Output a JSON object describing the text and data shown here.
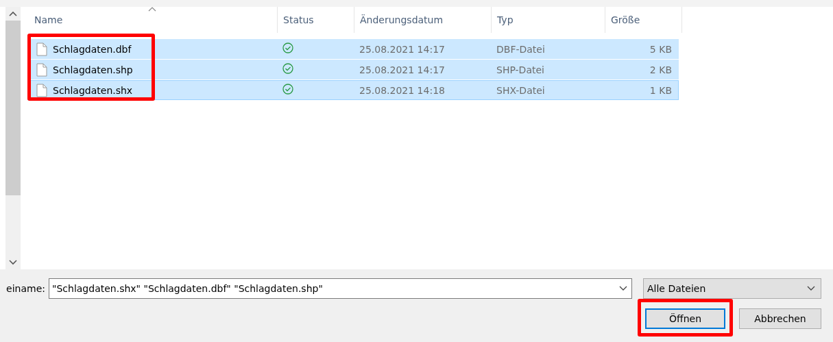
{
  "columns": [
    {
      "label": "Name",
      "sorted": true
    },
    {
      "label": "Status",
      "sorted": false
    },
    {
      "label": "Änderungsdatum",
      "sorted": false
    },
    {
      "label": "Typ",
      "sorted": false
    },
    {
      "label": "Größe",
      "sorted": false
    }
  ],
  "files": [
    {
      "name": "Schlagdaten.dbf",
      "synced": true,
      "date": "25.08.2021 14:17",
      "type": "DBF-Datei",
      "size": "5 KB",
      "selected": true,
      "focused": false
    },
    {
      "name": "Schlagdaten.shp",
      "synced": true,
      "date": "25.08.2021 14:17",
      "type": "SHP-Datei",
      "size": "2 KB",
      "selected": true,
      "focused": false
    },
    {
      "name": "Schlagdaten.shx",
      "synced": true,
      "date": "25.08.2021 14:18",
      "type": "SHX-Datei",
      "size": "1 KB",
      "selected": true,
      "focused": true
    }
  ],
  "names_highlighted": true,
  "filename": {
    "label": "einame:",
    "value": "\"Schlagdaten.shx\" \"Schlagdaten.dbf\" \"Schlagdaten.shp\""
  },
  "filter": {
    "value": "Alle Dateien"
  },
  "buttons": [
    {
      "label": "Öffnen",
      "default": true,
      "highlighted": true
    },
    {
      "label": "Abbrechen",
      "default": false,
      "highlighted": false
    }
  ]
}
